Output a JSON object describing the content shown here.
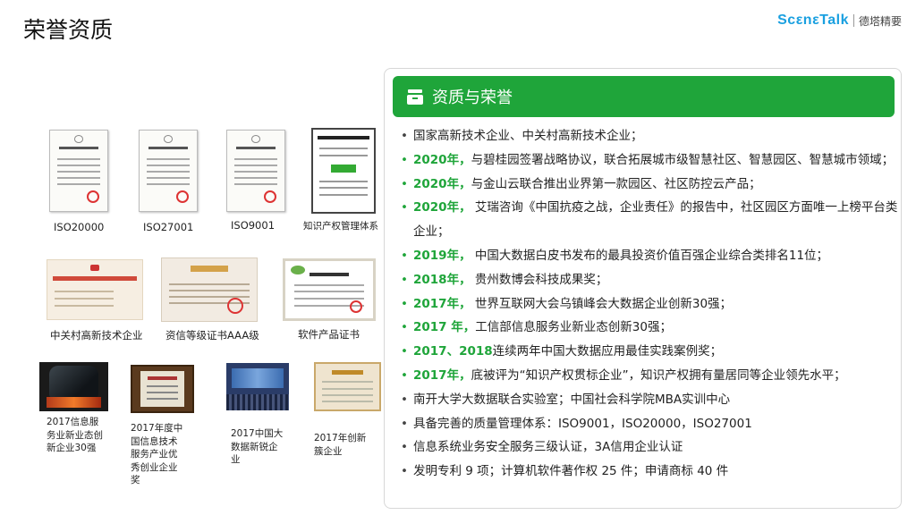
{
  "header": {
    "title": "荣誉资质",
    "brand_name": "ScεnεTalk",
    "brand_sub": "德塔精要"
  },
  "certificates": {
    "iso20000": "ISO20000",
    "iso27001": "ISO27001",
    "iso9001": "ISO9001",
    "ip_system": "知识产权管理体系",
    "zgc": "中关村高新技术企业",
    "credit_aaa": "资信等级证书AAA级",
    "software": "软件产品证书",
    "award1": "2017信息服务业新业态创新企业30强",
    "award2": "2017年度中国信息技术服务产业优秀创业企业奖",
    "award3": "2017中国大数据新锐企业",
    "award4": "2017年创新簇企业"
  },
  "panel": {
    "title": "资质与荣誉",
    "items": [
      {
        "year": "",
        "text": "国家高新技术企业、中关村高新技术企业；"
      },
      {
        "year": "2020年，",
        "text": "与碧桂园签署战略协议，联合拓展城市级智慧社区、智慧园区、智慧城市领域；"
      },
      {
        "year": "2020年，",
        "text": "与金山云联合推出业界第一款园区、社区防控云产品；"
      },
      {
        "year": "2020年，",
        "text": " 艾瑞咨询《中国抗疫之战，企业责任》的报告中，社区园区方面唯一上榜平台类企业；"
      },
      {
        "year": "2019年，",
        "text": " 中国大数据白皮书发布的最具投资价值百强企业综合类排名11位；"
      },
      {
        "year": "2018年，",
        "text": " 贵州数博会科技成果奖；"
      },
      {
        "year": "2017年，",
        "text": " 世界互联网大会乌镇峰会大数据企业创新30强；"
      },
      {
        "year": "2017 年，",
        "text": "工信部信息服务业新业态创新30强；"
      },
      {
        "year": "2017、2018",
        "text": "连续两年中国大数据应用最佳实践案例奖；"
      },
      {
        "year": "2017年，",
        "text": "底被评为“知识产权贯标企业”，知识产权拥有量居同等企业领先水平；"
      },
      {
        "year": "",
        "text": "南开大学大数据联合实验室；中国社会科学院MBA实训中心"
      },
      {
        "year": "",
        "text": "具备完善的质量管理体系：ISO9001，ISO20000，ISO27001"
      },
      {
        "year": "",
        "text": "信息系统业务安全服务三级认证，3A信用企业认证"
      },
      {
        "year": "",
        "text": "发明专利 9 项；计算机软件著作权 25 件；申请商标 40 件"
      }
    ]
  },
  "colors": {
    "accent_green": "#1fa53a",
    "brand_blue": "#1aa0e0"
  }
}
